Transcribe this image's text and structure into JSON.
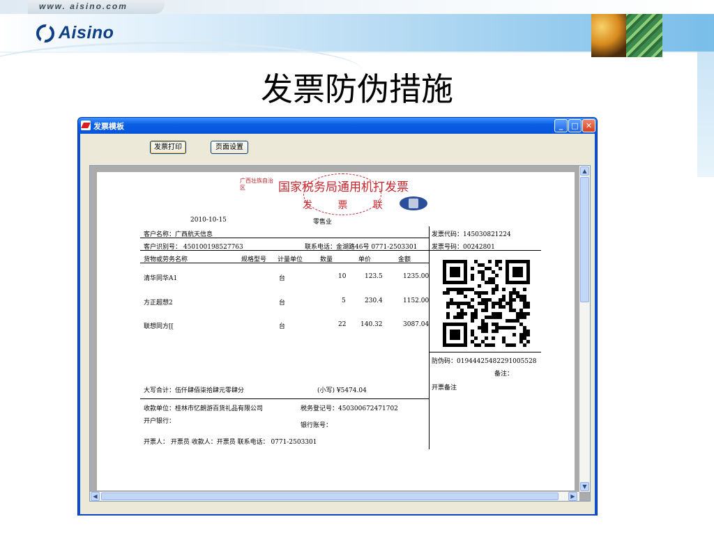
{
  "slide": {
    "site_url": "www. aisino.com",
    "logo_text": "Aisino",
    "title": "发票防伪措施"
  },
  "window": {
    "title": "发票模板",
    "buttons": {
      "print": "发票打印",
      "page_setup": "页面设置"
    },
    "controls": {
      "minimize": "_",
      "maximize": "□",
      "close": "✕"
    }
  },
  "invoice": {
    "region": "广西壮族自治区",
    "title": "国家税务局通用机打发票",
    "copy": "发 票 联",
    "date": "2010-10-15",
    "industry": "零售业",
    "customer_name": "客户名称：广西航天信息",
    "customer_id": "客户识别号： 450100198527763",
    "phone": "联系电话：金湖路46号 0771-2503301",
    "invoice_code": "发票代码：145030821224",
    "invoice_number": "发票号码：00242801",
    "table_headers": [
      "货物或劳务名称",
      "规格型号",
      "计量单位",
      "数量",
      "单价",
      "金额"
    ],
    "items": [
      {
        "name": "清华同华A1",
        "unit": "台",
        "qty": "10",
        "price": "123.5",
        "amount": "1235.00"
      },
      {
        "name": "方正超想2",
        "unit": "台",
        "qty": "5",
        "price": "230.4",
        "amount": "1152.00"
      },
      {
        "name": "联想同方[[",
        "unit": "台",
        "qty": "22",
        "price": "140.32",
        "amount": "3087.04"
      }
    ],
    "anti_counterfeit": "防伪码：01944425482291005528",
    "remark_label": "备注：",
    "remark_value": "开票备注",
    "total_upper": "大写合计：伍仟肆佰柒拾肆元零肆分",
    "total_lower": "(小写) ¥5474.04",
    "payee_unit": "收款单位：桂林市忆朗游百货礼品有限公司",
    "tax_reg": "税务登记号：450300672471702",
    "bank": "开户银行：",
    "account": "银行账号：",
    "footer": "开票人： 开票员     收款人：开票员   联系电话： 0771-2503301"
  },
  "colors": {
    "titlebar": "#0a5fe5",
    "invoice_red": "#c8252d",
    "brand_blue": "#0e3f86"
  }
}
